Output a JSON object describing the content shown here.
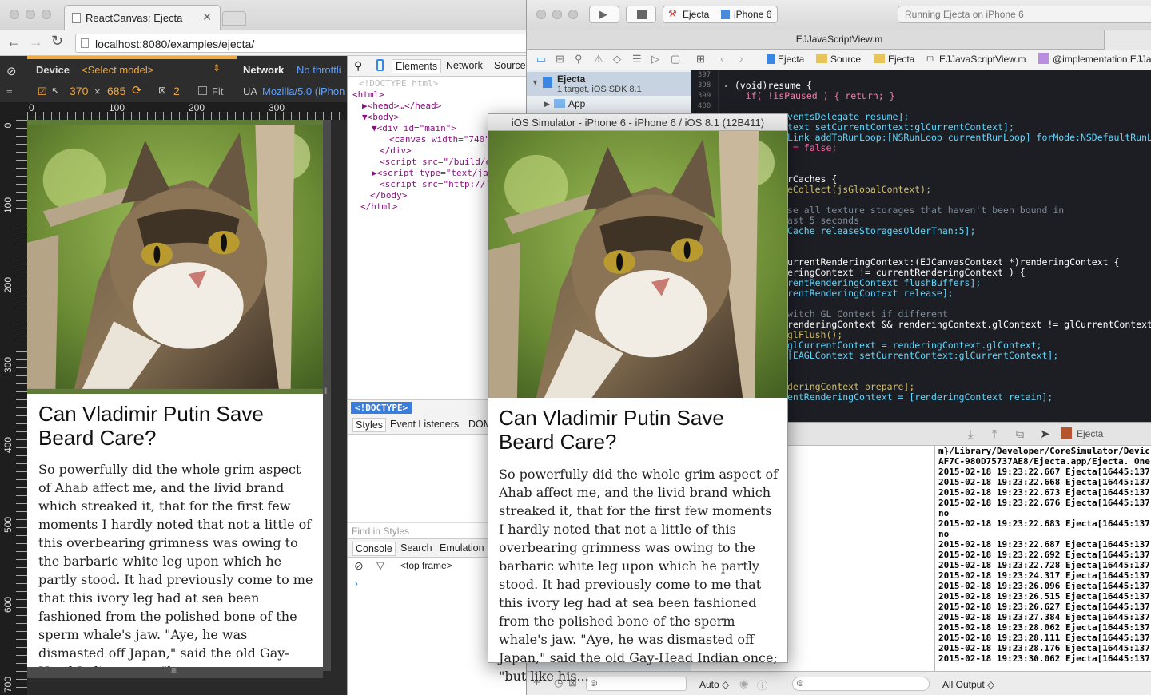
{
  "chrome": {
    "tab_title": "ReactCanvas: Ejecta",
    "url": "localhost:8080/examples/ejecta/"
  },
  "device_mode": {
    "device_label": "Device",
    "select_model": "<Select model>",
    "network_label": "Network",
    "throttle": "No throttli",
    "width": "370",
    "times": "×",
    "height": "685",
    "dpr": "2",
    "fit_label": "Fit",
    "ua_label": "UA",
    "ua_value": "Mozilla/5.0 (iPhon",
    "ruler_top": [
      "0",
      "100",
      "200",
      "300"
    ],
    "ruler_left": [
      "0",
      "100",
      "200",
      "300",
      "400",
      "500",
      "600",
      "700"
    ]
  },
  "article": {
    "headline": "Can Vladimir Putin Save Beard Care?",
    "body_short": "So powerfully did the whole grim aspect of Ahab affect me, and the livid brand which streaked it, that for the first few moments I hardly noted that not a little of this overbearing grimness was owing to the barbaric white leg upon which he partly stood. It had previously come to me that this ivory leg had at sea been fashioned from the polished bone of the sperm whale's jaw. \"Aye, he was dismasted off Japan,\" said the old Gay-Head Indian once; \"but...",
    "body_long": "So powerfully did the whole grim aspect of Ahab affect me, and the livid brand which streaked it, that for the first few moments I hardly noted that not a little of this overbearing grimness was owing to the barbaric white leg upon which he partly stood. It had previously come to me that this ivory leg had at sea been fashioned from the polished bone of the sperm whale's jaw. \"Aye, he was dismasted off Japan,\" said the old Gay-Head Indian once; \"but like his..."
  },
  "devtools": {
    "tabs": [
      "Elements",
      "Network",
      "Sources"
    ],
    "dom": [
      {
        "text": "<!DOCTYPE html>"
      },
      {
        "text": "<html>"
      },
      {
        "text": "▶<head>…</head>"
      },
      {
        "text": "▼<body>"
      },
      {
        "text": "▼<div id=\"main\">"
      },
      {
        "text": "<canvas width=\"740\""
      },
      {
        "text": "</div>"
      },
      {
        "text": "<script src=\"/build/e"
      },
      {
        "text": "▶<script type=\"text/ja"
      },
      {
        "text": "<script src=\"http://l"
      },
      {
        "text": "</body>"
      },
      {
        "text": "</html>"
      }
    ],
    "breadcrumb": "<!DOCTYPE>",
    "style_tabs": [
      "Styles",
      "Event Listeners",
      "DOM"
    ],
    "find_placeholder": "Find in Styles",
    "drawer_tabs": [
      "Console",
      "Search",
      "Emulation"
    ],
    "frame": "<top frame>",
    "prompt": "›"
  },
  "simulator": {
    "title": "iOS Simulator - iPhone 6 - iPhone 6 / iOS 8.1 (12B411)"
  },
  "xcode": {
    "scheme": "Ejecta",
    "device": "iPhone 6",
    "status": "Running Ejecta on iPhone 6",
    "file_tab": "EJJavaScriptView.m",
    "jump": [
      "Ejecta",
      "Source",
      "Ejecta",
      "EJJavaScriptView.m",
      "@implementation EJJav"
    ],
    "project_name": "Ejecta",
    "project_sub": "1 target, iOS SDK 8.1",
    "group": "App",
    "line_numbers": [
      "397",
      "398",
      "399",
      "400"
    ],
    "code": [
      "",
      "- (void)resume {",
      "    if( !isPaused ) { return; }",
      "",
      "ventsDelegate resume];",
      "text setCurrentContext:glCurrentContext];",
      "Link addToRunLoop:[NSRunLoop currentRunLoop] forMode:NSDefaultRunLoop",
      " = false;",
      "",
      "",
      "rCaches {",
      "eCollect(jsGlobalContext);",
      "",
      "se all texture storages that haven't been bound in",
      "ast 5 seconds",
      "Cache releaseStoragesOlderThan:5];",
      "",
      "",
      "urrentRenderingContext:(EJCanvasContext *)renderingContext {",
      "eringContext != currentRenderingContext ) {",
      "rentRenderingContext flushBuffers];",
      "rentRenderingContext release];",
      "",
      "witch GL Context if different",
      "renderingContext && renderingContext.glContext != glCurrentContext )",
      "glFlush();",
      "glCurrentContext = renderingContext.glContext;",
      "[EAGLContext setCurrentContext:glCurrentContext];",
      "",
      "",
      "deringContext prepare];",
      "entRenderingContext = [renderingContext retain];"
    ],
    "debug_target": "Ejecta",
    "console": [
      "m}/Library/Developer/CoreSimulator/Devic",
      "AF7C-980D75737AE8/Ejecta.app/Ejecta. One",
      "2015-02-18 19:23:22.667 Ejecta[16445:137",
      "2015-02-18 19:23:22.668 Ejecta[16445:137",
      "2015-02-18 19:23:22.673 Ejecta[16445:137",
      "2015-02-18 19:23:22.676 Ejecta[16445:137",
      "no",
      "2015-02-18 19:23:22.683 Ejecta[16445:137",
      "no",
      "2015-02-18 19:23:22.687 Ejecta[16445:137",
      "2015-02-18 19:23:22.692 Ejecta[16445:137",
      "2015-02-18 19:23:22.728 Ejecta[16445:137",
      "2015-02-18 19:23:24.317 Ejecta[16445:137",
      "2015-02-18 19:23:26.096 Ejecta[16445:137",
      "2015-02-18 19:23:26.515 Ejecta[16445:137",
      "2015-02-18 19:23:26.627 Ejecta[16445:137",
      "2015-02-18 19:23:27.384 Ejecta[16445:137",
      "2015-02-18 19:23:28.062 Ejecta[16445:137",
      "2015-02-18 19:23:28.111 Ejecta[16445:137",
      "2015-02-18 19:23:28.176 Ejecta[16445:137",
      "2015-02-18 19:23:30.062 Ejecta[16445:137"
    ],
    "auto_label": "Auto ◇",
    "output_label": "All Output ◇"
  }
}
